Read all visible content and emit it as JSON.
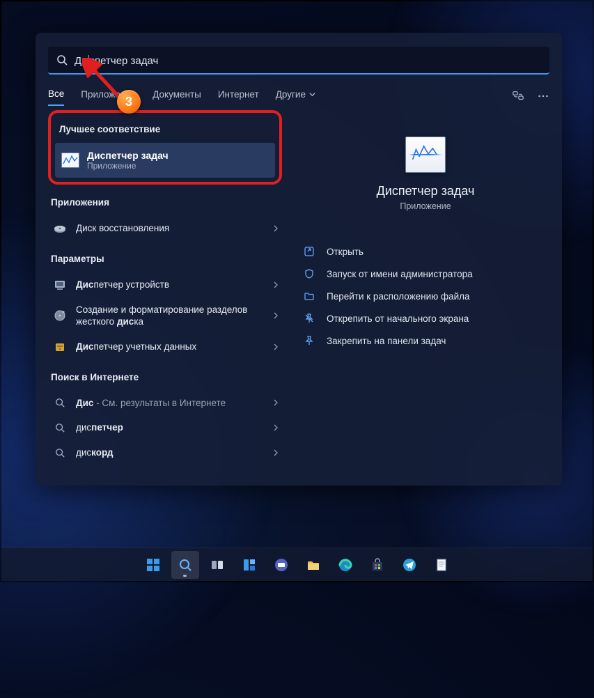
{
  "search": {
    "prefix": "Ди",
    "caret": true,
    "suffix": "спетчер задач"
  },
  "tabs": {
    "items": [
      {
        "label": "Все",
        "active": true
      },
      {
        "label": "Приложения",
        "active": false
      },
      {
        "label": "Документы",
        "active": false
      },
      {
        "label": "Интернет",
        "active": false
      },
      {
        "label": "Другие",
        "active": false,
        "dropdown": true
      }
    ]
  },
  "sections": {
    "best": "Лучшее соответствие",
    "apps": "Приложения",
    "settings": "Параметры",
    "web": "Поиск в Интернете"
  },
  "best_match": {
    "title": "Диспетчер задач",
    "sub": "Приложение"
  },
  "apps_list": [
    {
      "plain": "Диск восстановления",
      "bold": ""
    }
  ],
  "settings_list": [
    {
      "pre": "Дис",
      "mid": "петчер устройств",
      "post": ""
    },
    {
      "pre": "Создание и форматирование разделов жесткого ",
      "mid": "дис",
      "post": "ка"
    },
    {
      "pre": "Дис",
      "mid": "петчер учетных данных",
      "post": ""
    }
  ],
  "web_list": [
    {
      "pre": "Дис",
      "mid": "",
      "post": "",
      "hint": " - См. результаты в Интернете"
    },
    {
      "pre": "дис",
      "mid": "петчер",
      "post": ""
    },
    {
      "pre": "дис",
      "mid": "корд",
      "post": ""
    }
  ],
  "preview": {
    "title": "Диспетчер задач",
    "sub": "Приложение"
  },
  "actions": [
    {
      "label": "Открыть",
      "icon": "open"
    },
    {
      "label": "Запуск от имени администратора",
      "icon": "admin"
    },
    {
      "label": "Перейти к расположению файла",
      "icon": "folder"
    },
    {
      "label": "Открепить от начального экрана",
      "icon": "unpin-start"
    },
    {
      "label": "Закрепить на панели задач",
      "icon": "pin-taskbar"
    }
  ],
  "annotation": {
    "step": "3"
  }
}
